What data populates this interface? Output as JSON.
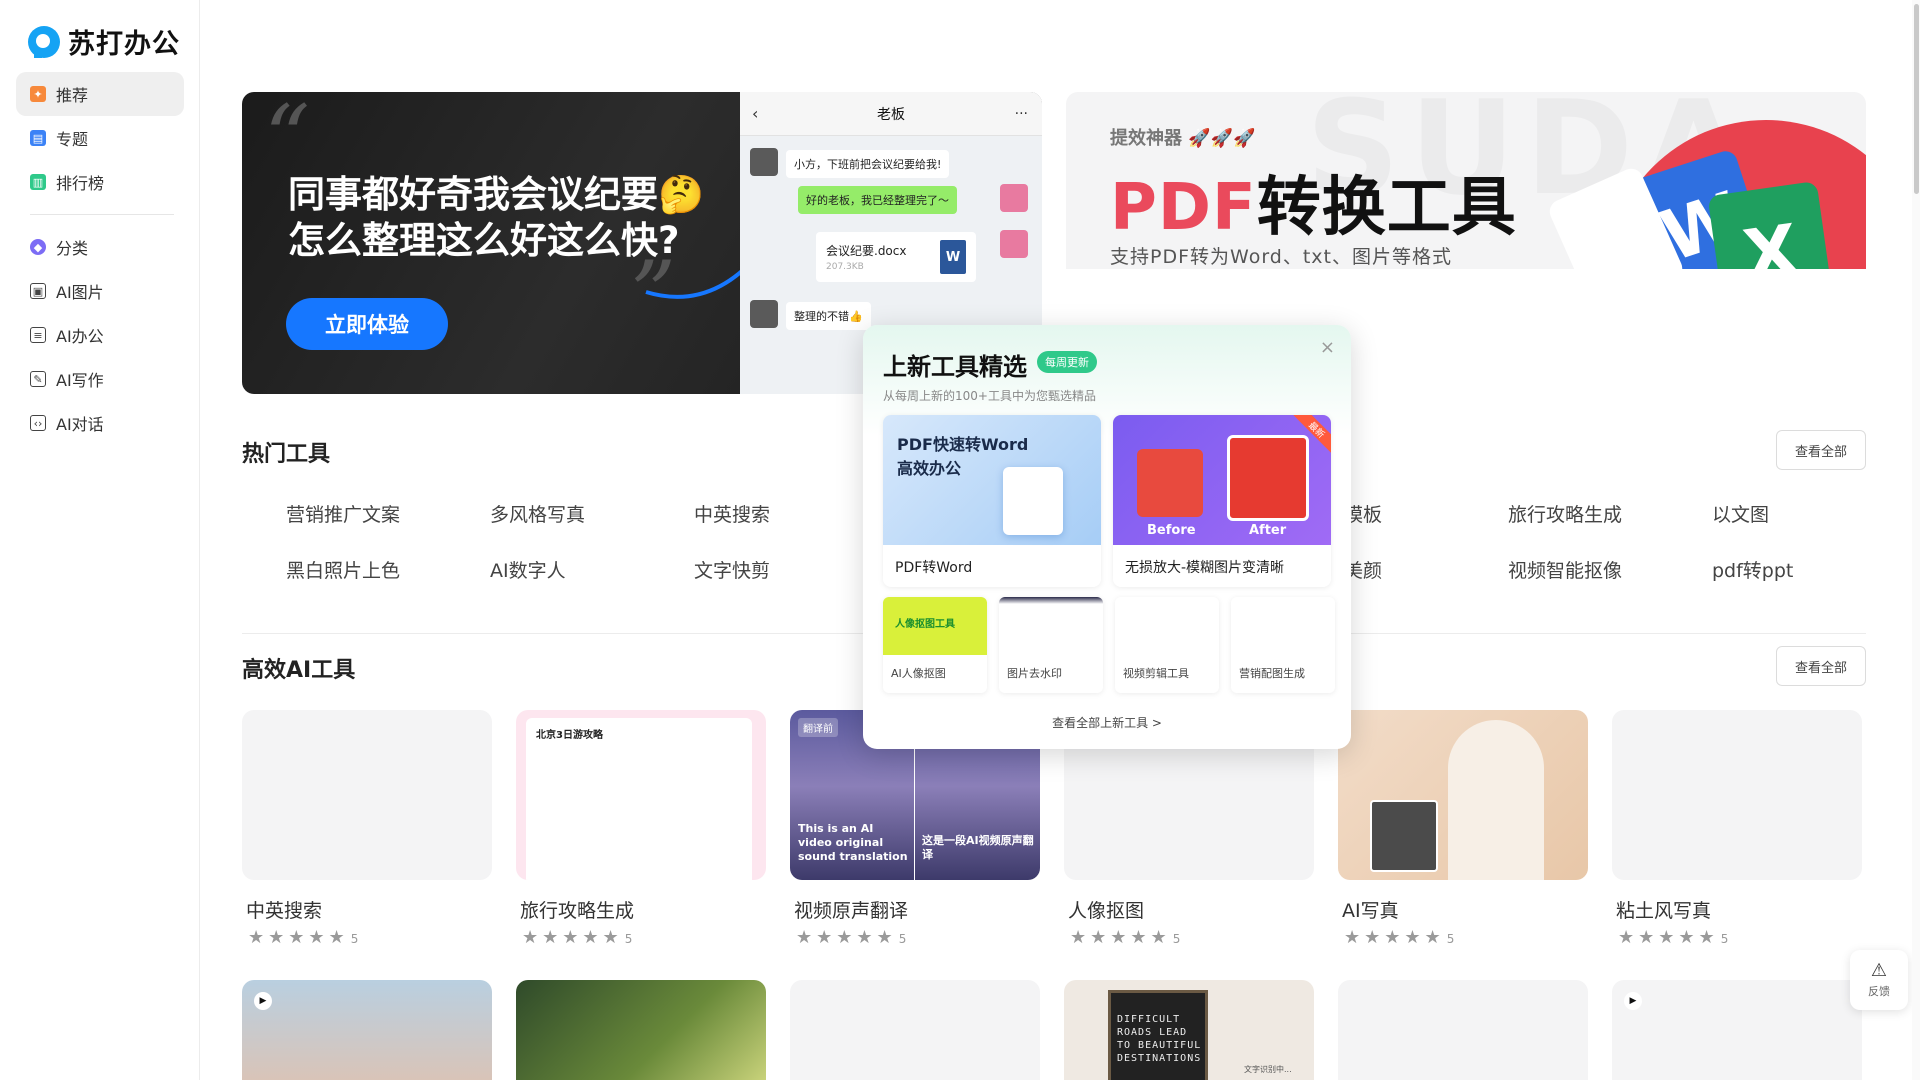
{
  "app": {
    "logo_text": "苏打办公"
  },
  "sidebar": {
    "items": [
      {
        "label": "推荐",
        "icon": "recommend-icon",
        "color": "#f7893b"
      },
      {
        "label": "专题",
        "icon": "topic-icon",
        "color": "#3b82f6"
      },
      {
        "label": "排行榜",
        "icon": "ranking-icon",
        "color": "#2fc98a"
      },
      {
        "label": "分类",
        "icon": "category-icon",
        "color": "#7c6cf5"
      },
      {
        "label": "AI图片",
        "icon": "ai-image-icon",
        "color": "#444444"
      },
      {
        "label": "AI办公",
        "icon": "ai-office-icon",
        "color": "#444444"
      },
      {
        "label": "AI写作",
        "icon": "ai-writing-icon",
        "color": "#444444"
      },
      {
        "label": "AI对话",
        "icon": "ai-chat-icon",
        "color": "#444444"
      }
    ]
  },
  "banner_left": {
    "title_line1": "同事都好奇我会议纪要🤔",
    "title_line2": "怎么整理这么好这么快?",
    "cta": "立即体验",
    "chat": {
      "header": "老板",
      "msg1": "小方，下班前把会议纪要给我!",
      "msg2": "好的老板，我已经整理完了～",
      "file_name": "会议纪要.docx",
      "file_size": "207.3KB",
      "file_icon": "W",
      "msg3": "整理的不错👍"
    }
  },
  "banner_right": {
    "watermark": "SUDA",
    "small": "提效神器 🚀🚀🚀",
    "big_red": "PDF",
    "big_rest": "转换工具",
    "sub": "支持PDF转为Word、txt、图片等格式",
    "card1": "W",
    "card2": "X"
  },
  "hot_tools": {
    "title": "热门工具",
    "view_all": "查看全部",
    "row1": [
      "营销推广文案",
      "多风格写真",
      "中英搜索",
      "模板",
      "旅行攻略生成",
      "以文图"
    ],
    "row2": [
      "黑白照片上色",
      "AI数字人",
      "文字快剪",
      "美颜",
      "视频智能抠像",
      "pdf转ppt"
    ]
  },
  "ai_tools": {
    "title": "高效AI工具",
    "view_all": "查看全部",
    "cards": [
      {
        "title": "中英搜索",
        "rating": "5"
      },
      {
        "title": "旅行攻略生成",
        "rating": "5",
        "thumb_text": "北京3日游攻略"
      },
      {
        "title": "视频原声翻译",
        "rating": "5",
        "thumb_tag": "翻译前",
        "thumb_left": "This is an AI video original sound translation",
        "thumb_right": "这是一段AI视频原声翻译"
      },
      {
        "title": "人像抠图",
        "rating": "5"
      },
      {
        "title": "AI写真",
        "rating": "5"
      },
      {
        "title": "粘土风写真",
        "rating": "5"
      }
    ],
    "stars": "★★★★★"
  },
  "bottom_row": {
    "sign_text": "DIFFICULT ROADS LEAD TO BEAUTIFUL DESTINATIONS",
    "caption": "文字识别中..."
  },
  "popup": {
    "title": "上新工具精选",
    "badge": "每周更新",
    "subtitle": "从每周上新的100+工具中为您甄选精品",
    "close": "×",
    "feature1": {
      "image_text1": "PDF快速转Word",
      "image_text2": "高效办公",
      "label": "PDF转Word"
    },
    "feature2": {
      "before": "Before",
      "after": "After",
      "ribbon": "最新",
      "label": "无损放大-模糊图片变清晰"
    },
    "minis": [
      "AI人像抠图",
      "图片去水印",
      "视频剪辑工具",
      "营销配图生成"
    ],
    "mini1_image_text": "人像抠图工具",
    "footer": "查看全部上新工具 >"
  },
  "feedback": {
    "label": "反馈",
    "icon": "feedback-icon"
  }
}
